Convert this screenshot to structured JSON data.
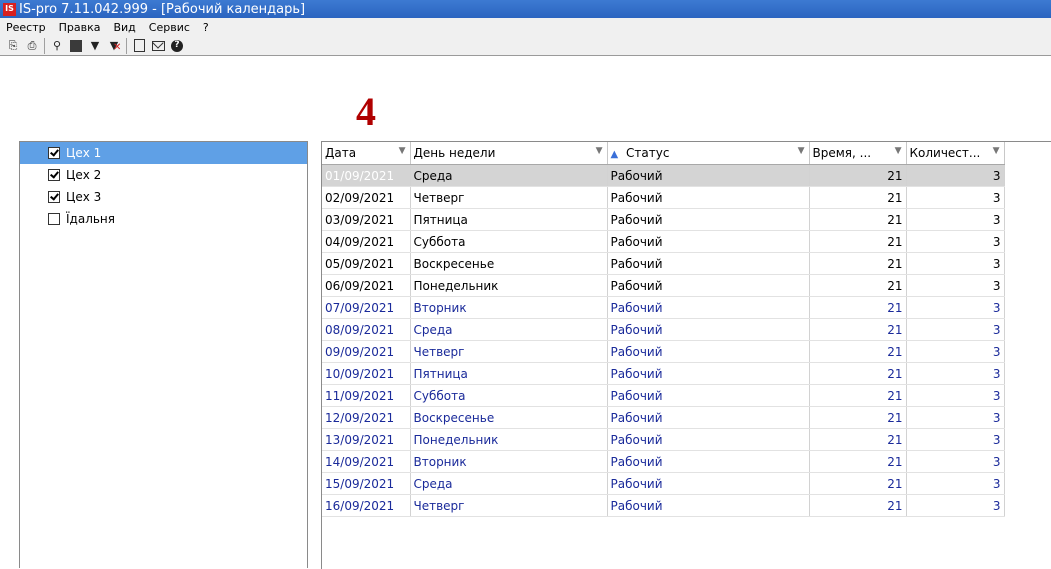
{
  "window": {
    "title": "IS-pro 7.11.042.999 - [Рабочий календарь]",
    "logo": "IS"
  },
  "menu": [
    "Реестр",
    "Правка",
    "Вид",
    "Сервис",
    "?"
  ],
  "toolbar": {
    "icons": [
      "new-document-icon",
      "print-icon",
      "search-icon",
      "stop-icon",
      "filter-icon",
      "clear-filter-icon",
      "document-icon",
      "mail-icon",
      "help-icon"
    ],
    "glyphs": {
      "new": "⎘",
      "print": "⎙",
      "search": "⚲",
      "filter": "▼",
      "clear_x": "✕",
      "help": "?"
    }
  },
  "annotation": "4",
  "tree": {
    "items": [
      {
        "label": "Цех 1",
        "checked": true,
        "selected": true
      },
      {
        "label": "Цех 2",
        "checked": true,
        "selected": false
      },
      {
        "label": "Цех 3",
        "checked": true,
        "selected": false
      },
      {
        "label": "Їдальня",
        "checked": false,
        "selected": false
      }
    ]
  },
  "grid": {
    "columns": [
      {
        "label": "Дата"
      },
      {
        "label": "День недели"
      },
      {
        "label": "Статус",
        "sort": "asc"
      },
      {
        "label": "Время, ..."
      },
      {
        "label": "Количест..."
      }
    ],
    "rows": [
      {
        "date": "01/09/2021",
        "day": "Среда",
        "status": "Рабочий",
        "time": "21",
        "count": "3",
        "selected": true,
        "blue": false
      },
      {
        "date": "02/09/2021",
        "day": "Четверг",
        "status": "Рабочий",
        "time": "21",
        "count": "3",
        "selected": false,
        "blue": false
      },
      {
        "date": "03/09/2021",
        "day": "Пятница",
        "status": "Рабочий",
        "time": "21",
        "count": "3",
        "selected": false,
        "blue": false
      },
      {
        "date": "04/09/2021",
        "day": "Суббота",
        "status": "Рабочий",
        "time": "21",
        "count": "3",
        "selected": false,
        "blue": false
      },
      {
        "date": "05/09/2021",
        "day": "Воскресенье",
        "status": "Рабочий",
        "time": "21",
        "count": "3",
        "selected": false,
        "blue": false
      },
      {
        "date": "06/09/2021",
        "day": "Понедельник",
        "status": "Рабочий",
        "time": "21",
        "count": "3",
        "selected": false,
        "blue": false
      },
      {
        "date": "07/09/2021",
        "day": "Вторник",
        "status": "Рабочий",
        "time": "21",
        "count": "3",
        "selected": false,
        "blue": true
      },
      {
        "date": "08/09/2021",
        "day": "Среда",
        "status": "Рабочий",
        "time": "21",
        "count": "3",
        "selected": false,
        "blue": true
      },
      {
        "date": "09/09/2021",
        "day": "Четверг",
        "status": "Рабочий",
        "time": "21",
        "count": "3",
        "selected": false,
        "blue": true
      },
      {
        "date": "10/09/2021",
        "day": "Пятница",
        "status": "Рабочий",
        "time": "21",
        "count": "3",
        "selected": false,
        "blue": true
      },
      {
        "date": "11/09/2021",
        "day": "Суббота",
        "status": "Рабочий",
        "time": "21",
        "count": "3",
        "selected": false,
        "blue": true
      },
      {
        "date": "12/09/2021",
        "day": "Воскресенье",
        "status": "Рабочий",
        "time": "21",
        "count": "3",
        "selected": false,
        "blue": true
      },
      {
        "date": "13/09/2021",
        "day": "Понедельник",
        "status": "Рабочий",
        "time": "21",
        "count": "3",
        "selected": false,
        "blue": true
      },
      {
        "date": "14/09/2021",
        "day": "Вторник",
        "status": "Рабочий",
        "time": "21",
        "count": "3",
        "selected": false,
        "blue": true
      },
      {
        "date": "15/09/2021",
        "day": "Среда",
        "status": "Рабочий",
        "time": "21",
        "count": "3",
        "selected": false,
        "blue": true
      },
      {
        "date": "16/09/2021",
        "day": "Четверг",
        "status": "Рабочий",
        "time": "21",
        "count": "3",
        "selected": false,
        "blue": true
      }
    ]
  },
  "colors": {
    "title_bar": "#2b64c0",
    "selection": "#5fa0e6",
    "annotation": "#b00000",
    "row_text_blue": "#1a2a9a",
    "logo": "#d8201f"
  }
}
